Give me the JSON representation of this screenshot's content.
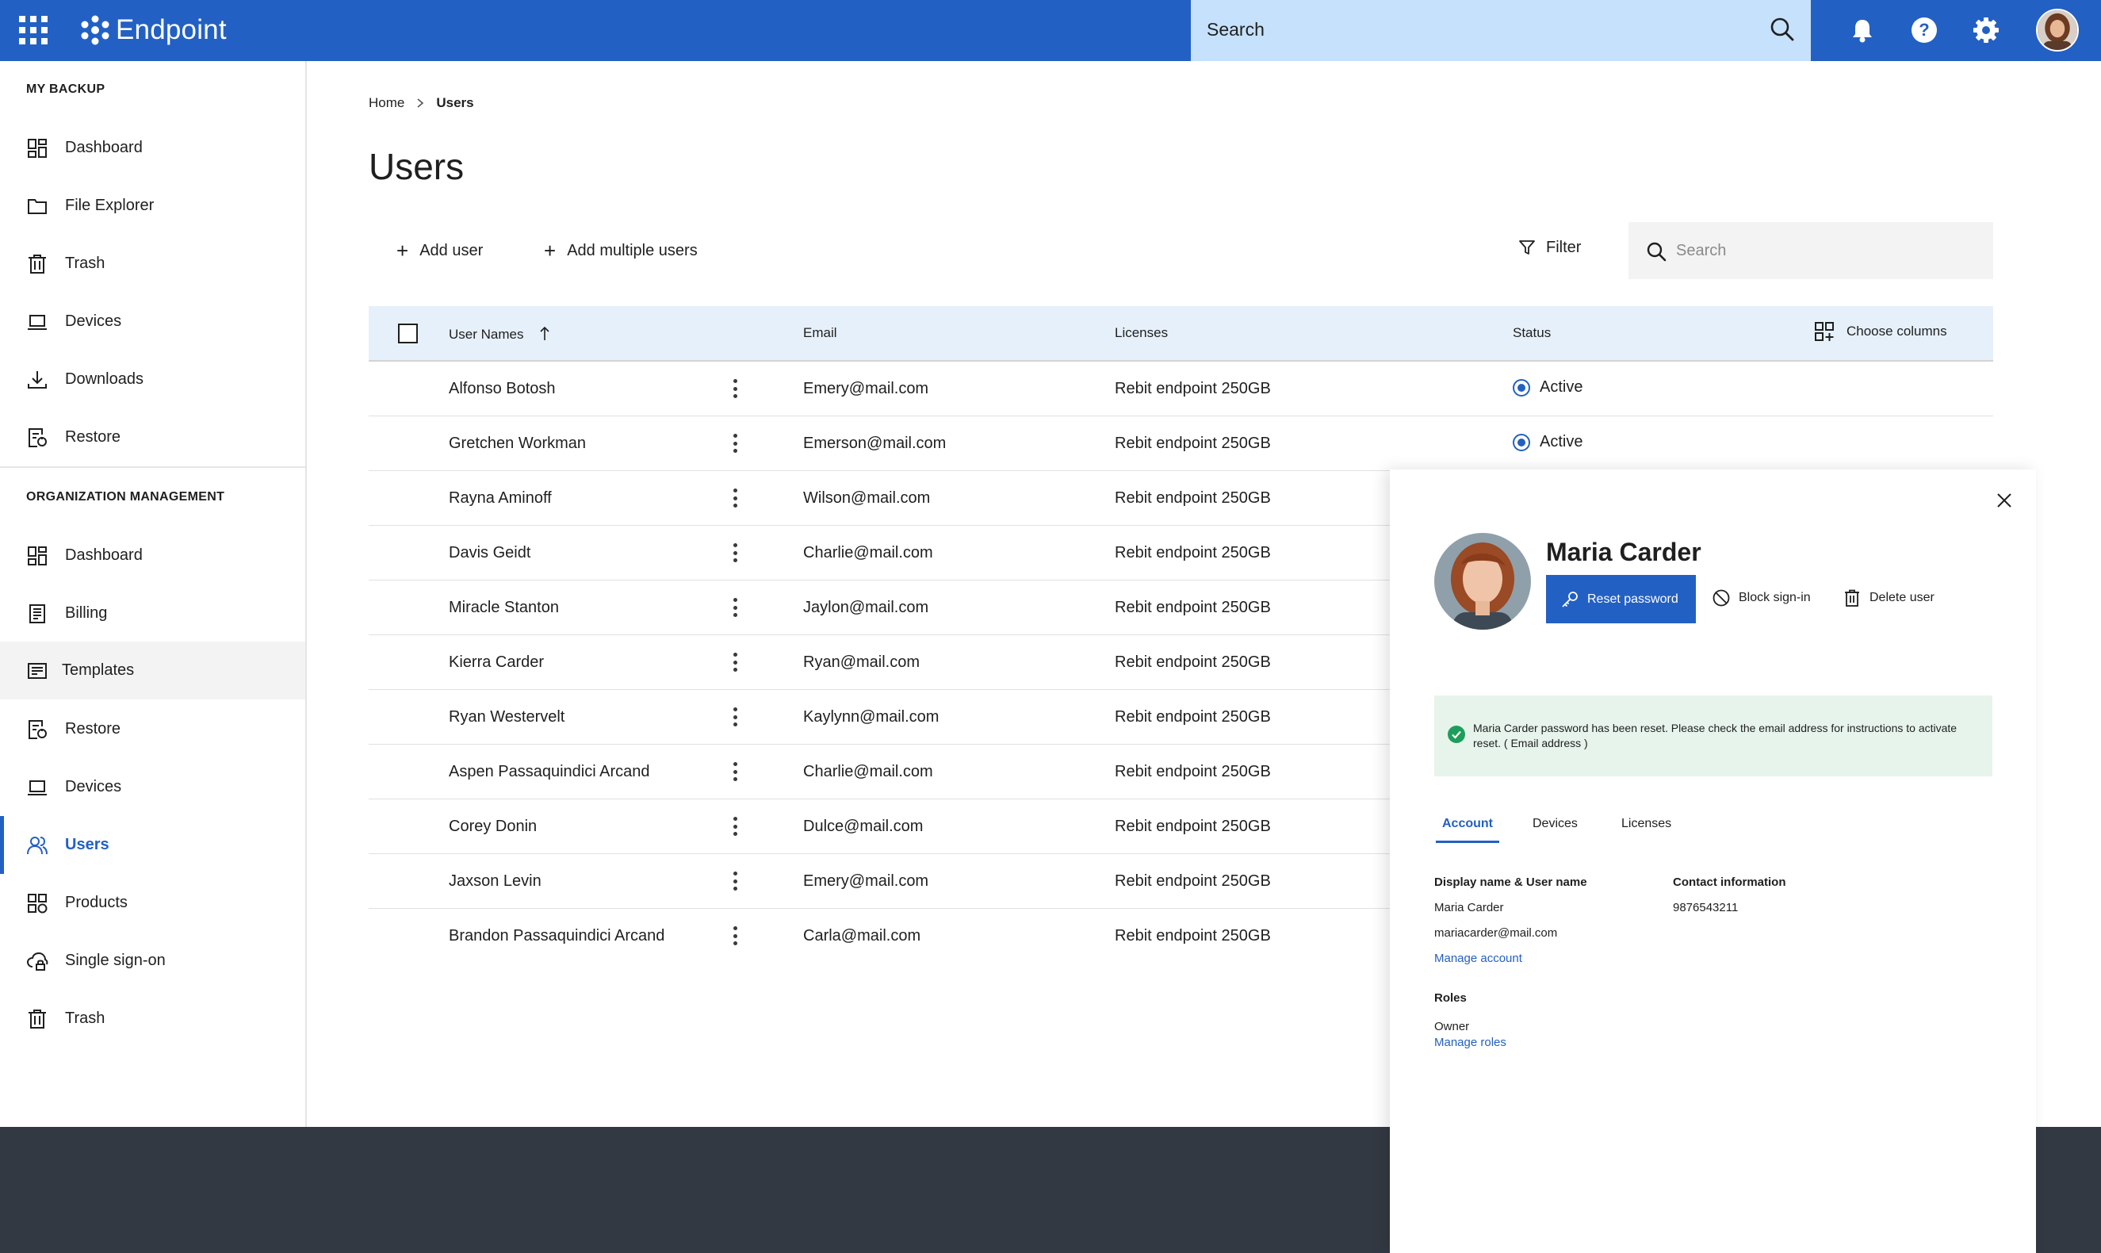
{
  "app": {
    "title": "Endpoint",
    "search_placeholder": "Search"
  },
  "topbar_icons": [
    "apps-grid-icon",
    "bell-icon",
    "help-icon",
    "gear-icon",
    "user-avatar"
  ],
  "sidebar": {
    "sections": [
      {
        "heading": "MY BACKUP",
        "items": [
          {
            "label": "Dashboard",
            "icon": "dashboard-icon"
          },
          {
            "label": "File Explorer",
            "icon": "folder-icon"
          },
          {
            "label": "Trash",
            "icon": "trash-icon"
          },
          {
            "label": "Devices",
            "icon": "laptop-icon"
          },
          {
            "label": "Downloads",
            "icon": "download-icon"
          },
          {
            "label": "Restore",
            "icon": "restore-icon"
          }
        ]
      },
      {
        "heading": "ORGANIZATION MANAGEMENT",
        "items": [
          {
            "label": "Dashboard",
            "icon": "dashboard-icon"
          },
          {
            "label": "Billing",
            "icon": "receipt-icon"
          },
          {
            "label": "Templates",
            "icon": "template-icon"
          },
          {
            "label": "Restore",
            "icon": "restore-icon"
          },
          {
            "label": "Devices",
            "icon": "laptop-icon"
          },
          {
            "label": "Users",
            "icon": "users-icon"
          },
          {
            "label": "Products",
            "icon": "products-icon"
          },
          {
            "label": "Single sign-on",
            "icon": "cloud-lock-icon"
          },
          {
            "label": "Trash",
            "icon": "trash-icon"
          }
        ]
      }
    ],
    "active_item": "Users",
    "hovered_item": "Templates"
  },
  "breadcrumb": {
    "home": "Home",
    "current": "Users"
  },
  "page": {
    "title": "Users",
    "add_user": "Add user",
    "add_multiple": "Add multiple users",
    "filter": "Filter",
    "search_placeholder": "Search"
  },
  "table": {
    "headers": {
      "name": "User Names",
      "email": "Email",
      "licenses": "Licenses",
      "status": "Status",
      "choose_columns": "Choose columns"
    },
    "rows": [
      {
        "name": "Alfonso Botosh",
        "email": "Emery@mail.com",
        "license": "Rebit endpoint 250GB",
        "status": "Active"
      },
      {
        "name": "Gretchen Workman",
        "email": "Emerson@mail.com",
        "license": "Rebit endpoint 250GB",
        "status": "Active"
      },
      {
        "name": "Rayna Aminoff",
        "email": "Wilson@mail.com",
        "license": "Rebit endpoint 250GB",
        "status": ""
      },
      {
        "name": "Davis Geidt",
        "email": "Charlie@mail.com",
        "license": "Rebit endpoint 250GB",
        "status": ""
      },
      {
        "name": "Miracle Stanton",
        "email": "Jaylon@mail.com",
        "license": "Rebit endpoint 250GB",
        "status": ""
      },
      {
        "name": "Kierra Carder",
        "email": "Ryan@mail.com",
        "license": "Rebit endpoint 250GB",
        "status": ""
      },
      {
        "name": "Ryan Westervelt",
        "email": "Kaylynn@mail.com",
        "license": "Rebit endpoint 250GB",
        "status": ""
      },
      {
        "name": "Aspen Passaquindici Arcand",
        "email": "Charlie@mail.com",
        "license": "Rebit endpoint 250GB",
        "status": ""
      },
      {
        "name": "Corey Donin",
        "email": "Dulce@mail.com",
        "license": "Rebit endpoint 250GB",
        "status": ""
      },
      {
        "name": "Jaxson Levin",
        "email": "Emery@mail.com",
        "license": "Rebit endpoint 250GB",
        "status": ""
      },
      {
        "name": "Brandon Passaquindici Arcand",
        "email": "Carla@mail.com",
        "license": "Rebit endpoint 250GB",
        "status": ""
      }
    ]
  },
  "panel": {
    "name": "Maria Carder",
    "reset_password": "Reset password",
    "block_signin": "Block sign-in",
    "delete_user": "Delete user",
    "notice": "Maria Carder password has been reset. Please check the email address for instructions to activate reset. ( Email address )",
    "tabs": [
      "Account",
      "Devices",
      "Licenses"
    ],
    "active_tab": "Account",
    "display_name_label": "Display name & User name",
    "display_name": "Maria Carder",
    "user_name": "mariacarder@mail.com",
    "manage_account": "Manage account",
    "contact_label": "Contact information",
    "phone": "9876543211",
    "roles_label": "Roles",
    "role": "Owner",
    "manage_roles": "Manage roles"
  },
  "colors": {
    "brand": "#2360c4",
    "search_bg": "#c5e1fb",
    "notice_bg": "#e7f4ec",
    "success": "#1e9e5a",
    "footer": "#333942"
  }
}
